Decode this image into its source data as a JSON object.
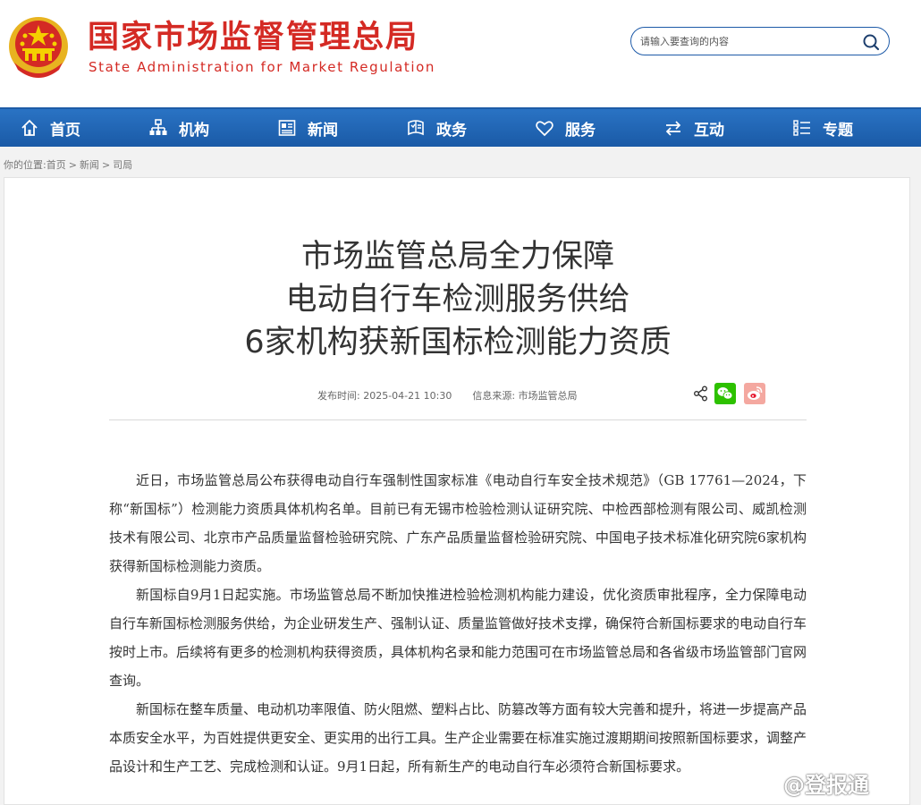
{
  "header": {
    "site_title": "国家市场监督管理总局",
    "site_subtitle": "State Administration for Market Regulation",
    "search_placeholder": "请输入要查询的内容"
  },
  "nav": {
    "items": [
      {
        "label": "首页",
        "icon": "home-icon"
      },
      {
        "label": "机构",
        "icon": "org-chart-icon"
      },
      {
        "label": "新闻",
        "icon": "news-icon"
      },
      {
        "label": "政务",
        "icon": "government-icon"
      },
      {
        "label": "服务",
        "icon": "heart-icon"
      },
      {
        "label": "互动",
        "icon": "exchange-icon"
      },
      {
        "label": "专题",
        "icon": "list-icon"
      }
    ]
  },
  "breadcrumb": {
    "prefix": "你的位置:",
    "items": [
      "首页",
      "新闻",
      "司局"
    ],
    "separator": ">"
  },
  "article": {
    "title_lines": [
      "市场监管总局全力保障",
      "电动自行车检测服务供给",
      "6家机构获新国标检测能力资质"
    ],
    "publish_label": "发布时间:",
    "publish_time": "2025-04-21 10:30",
    "source_label": "信息来源:",
    "source": "市场监管总局",
    "paragraphs": [
      "近日，市场监管总局公布获得电动自行车强制性国家标准《电动自行车安全技术规范》（GB 17761—2024，下称“新国标”）检测能力资质具体机构名单。目前已有无锡市检验检测认证研究院、中检西部检测有限公司、威凯检测技术有限公司、北京市产品质量监督检验研究院、广东产品质量监督检验研究院、中国电子技术标准化研究院6家机构获得新国标检测能力资质。",
      "新国标自9月1日起实施。市场监管总局不断加快推进检验检测机构能力建设，优化资质审批程序，全力保障电动自行车新国标检测服务供给，为企业研发生产、强制认证、质量监管做好技术支撑，确保符合新国标要求的电动自行车按时上市。后续将有更多的检测机构获得资质，具体机构名录和能力范围可在市场监管总局和各省级市场监管部门官网查询。",
      "新国标在整车质量、电动机功率限值、防火阻燃、塑料占比、防篡改等方面有较大完善和提升，将进一步提高产品本质安全水平，为百姓提供更安全、更实用的出行工具。生产企业需要在标准实施过渡期期间按照新国标要求，调整产品设计和生产工艺、完成检测和认证。9月1日起，所有新生产的电动自行车必须符合新国标要求。"
    ]
  },
  "watermark": "@登报通",
  "colors": {
    "brand_red": "#d42a24",
    "nav_blue": "#1a5aa6",
    "wechat_green": "#2dc100",
    "weibo_red": "#e6162d"
  }
}
